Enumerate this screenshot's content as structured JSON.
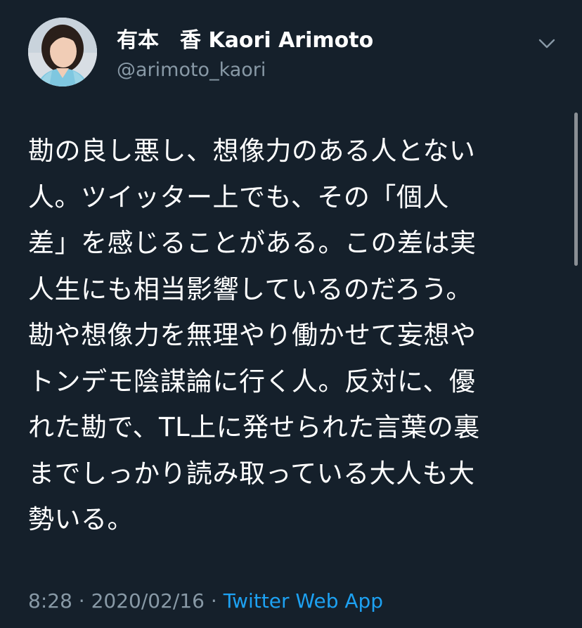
{
  "user": {
    "display_name": "有本　香  Kaori Arimoto",
    "handle": "@arimoto_kaori",
    "avatar_icon": "user-avatar"
  },
  "tweet": {
    "lines": [
      "勘の良し悪し、想像力のある人とない",
      "人。ツイッター上でも、その「個人",
      "差」を感じることがある。この差は実",
      "人生にも相当影響しているのだろう。",
      "勘や想像力を無理やり働かせて妄想や",
      "トンデモ陰謀論に行く人。反対に、優",
      "れた勘で、TL上に発せられた言葉の裏",
      "までしっかり読み取っている大人も大",
      "勢いる。"
    ]
  },
  "meta": {
    "time": "8:28",
    "sep1": " · ",
    "date": "2020/02/16",
    "sep2": " · ",
    "source": "Twitter Web App"
  },
  "colors": {
    "background": "#15202b",
    "text": "#ffffff",
    "secondary": "#8899a6",
    "link": "#1da1f2"
  },
  "icons": {
    "more": "chevron-down-icon"
  }
}
